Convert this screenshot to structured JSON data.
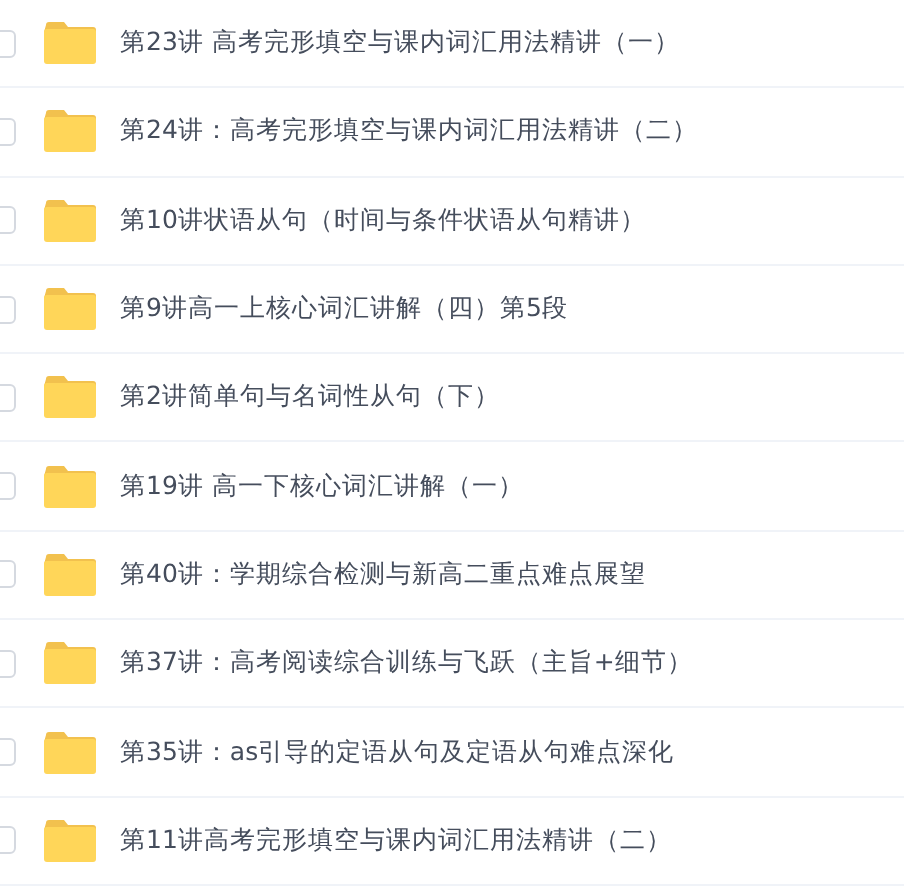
{
  "folders": [
    {
      "name": "第23讲 高考完形填空与课内词汇用法精讲（一）",
      "checked": false
    },
    {
      "name": "第24讲：高考完形填空与课内词汇用法精讲（二）",
      "checked": false
    },
    {
      "name": "第10讲状语从句（时间与条件状语从句精讲）",
      "checked": false
    },
    {
      "name": "第9讲高一上核心词汇讲解（四）第5段",
      "checked": false
    },
    {
      "name": "第2讲简单句与名词性从句（下）",
      "checked": false
    },
    {
      "name": "第19讲 高一下核心词汇讲解（一）",
      "checked": false
    },
    {
      "name": "第40讲：学期综合检测与新高二重点难点展望",
      "checked": false
    },
    {
      "name": "第37讲：高考阅读综合训练与飞跃（主旨+细节）",
      "checked": false
    },
    {
      "name": "第35讲：as引导的定语从句及定语从句难点深化",
      "checked": false
    },
    {
      "name": "第11讲高考完形填空与课内词汇用法精讲（二）",
      "checked": false
    }
  ]
}
